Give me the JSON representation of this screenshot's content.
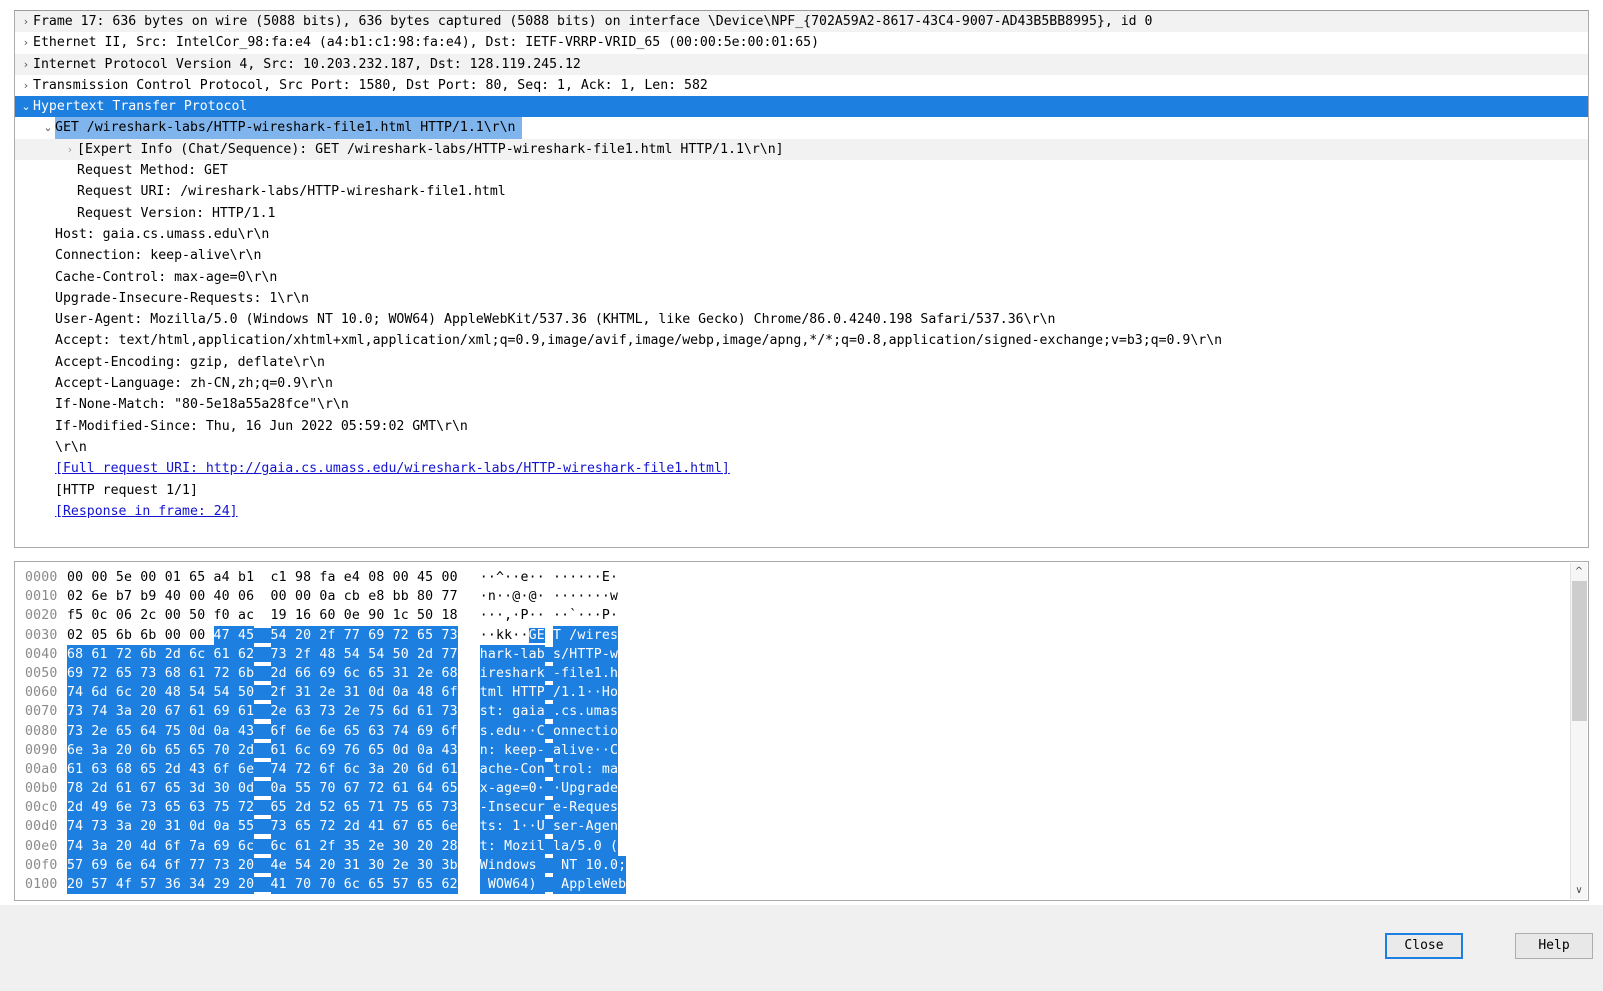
{
  "detail_tree": [
    {
      "indent": 0,
      "arrow": "collapsed",
      "state": "alt",
      "text": "Frame 17: 636 bytes on wire (5088 bits), 636 bytes captured (5088 bits) on interface \\Device\\NPF_{702A59A2-8617-43C4-9007-AD43B5BB8995}, id 0"
    },
    {
      "indent": 0,
      "arrow": "collapsed",
      "state": "plain",
      "text": "Ethernet II, Src: IntelCor_98:fa:e4 (a4:b1:c1:98:fa:e4), Dst: IETF-VRRP-VRID_65 (00:00:5e:00:01:65)"
    },
    {
      "indent": 0,
      "arrow": "collapsed",
      "state": "alt",
      "text": "Internet Protocol Version 4, Src: 10.203.232.187, Dst: 128.119.245.12"
    },
    {
      "indent": 0,
      "arrow": "collapsed",
      "state": "plain",
      "text": "Transmission Control Protocol, Src Port: 1580, Dst Port: 80, Seq: 1, Ack: 1, Len: 582"
    },
    {
      "indent": 0,
      "arrow": "expanded",
      "state": "selected",
      "text": "Hypertext Transfer Protocol"
    },
    {
      "indent": 1,
      "arrow": "expanded",
      "state": "selected-partial",
      "text": "GET /wireshark-labs/HTTP-wireshark-file1.html HTTP/1.1\\r\\n"
    },
    {
      "indent": 2,
      "arrow": "collapsed-light",
      "state": "alt",
      "text": "[Expert Info (Chat/Sequence): GET /wireshark-labs/HTTP-wireshark-file1.html HTTP/1.1\\r\\n]"
    },
    {
      "indent": 2,
      "arrow": "none",
      "state": "plain",
      "text": "Request Method: GET"
    },
    {
      "indent": 2,
      "arrow": "none",
      "state": "plain",
      "text": "Request URI: /wireshark-labs/HTTP-wireshark-file1.html"
    },
    {
      "indent": 2,
      "arrow": "none",
      "state": "plain",
      "text": "Request Version: HTTP/1.1"
    },
    {
      "indent": 1,
      "arrow": "none",
      "state": "plain",
      "text": "Host: gaia.cs.umass.edu\\r\\n"
    },
    {
      "indent": 1,
      "arrow": "none",
      "state": "plain",
      "text": "Connection: keep-alive\\r\\n"
    },
    {
      "indent": 1,
      "arrow": "none",
      "state": "plain",
      "text": "Cache-Control: max-age=0\\r\\n"
    },
    {
      "indent": 1,
      "arrow": "none",
      "state": "plain",
      "text": "Upgrade-Insecure-Requests: 1\\r\\n"
    },
    {
      "indent": 1,
      "arrow": "none",
      "state": "plain",
      "text": "User-Agent: Mozilla/5.0 (Windows NT 10.0; WOW64) AppleWebKit/537.36 (KHTML, like Gecko) Chrome/86.0.4240.198 Safari/537.36\\r\\n"
    },
    {
      "indent": 1,
      "arrow": "none",
      "state": "plain",
      "text": "Accept: text/html,application/xhtml+xml,application/xml;q=0.9,image/avif,image/webp,image/apng,*/*;q=0.8,application/signed-exchange;v=b3;q=0.9\\r\\n"
    },
    {
      "indent": 1,
      "arrow": "none",
      "state": "plain",
      "text": "Accept-Encoding: gzip, deflate\\r\\n"
    },
    {
      "indent": 1,
      "arrow": "none",
      "state": "plain",
      "text": "Accept-Language: zh-CN,zh;q=0.9\\r\\n"
    },
    {
      "indent": 1,
      "arrow": "none",
      "state": "plain",
      "text": "If-None-Match: \"80-5e18a55a28fce\"\\r\\n"
    },
    {
      "indent": 1,
      "arrow": "none",
      "state": "plain",
      "text": "If-Modified-Since: Thu, 16 Jun 2022 05:59:02 GMT\\r\\n"
    },
    {
      "indent": 1,
      "arrow": "none",
      "state": "plain",
      "text": "\\r\\n"
    },
    {
      "indent": 1,
      "arrow": "none",
      "state": "plain",
      "link": true,
      "text": "[Full request URI: http://gaia.cs.umass.edu/wireshark-labs/HTTP-wireshark-file1.html]"
    },
    {
      "indent": 1,
      "arrow": "none",
      "state": "plain",
      "text": "[HTTP request 1/1]"
    },
    {
      "indent": 1,
      "arrow": "none",
      "state": "plain",
      "link": true,
      "text": "[Response in frame: 24]"
    }
  ],
  "hex_dump": {
    "rows": [
      {
        "offset": "0000",
        "bytes": [
          "00",
          "00",
          "5e",
          "00",
          "01",
          "65",
          "a4",
          "b1",
          "c1",
          "98",
          "fa",
          "e4",
          "08",
          "00",
          "45",
          "00"
        ],
        "ascii_left": "··^··e··",
        "ascii_right": "······E·",
        "hl_start": 16
      },
      {
        "offset": "0010",
        "bytes": [
          "02",
          "6e",
          "b7",
          "b9",
          "40",
          "00",
          "40",
          "06",
          "00",
          "00",
          "0a",
          "cb",
          "e8",
          "bb",
          "80",
          "77"
        ],
        "ascii_left": "·n··@·@·",
        "ascii_right": "·······w",
        "hl_start": 16
      },
      {
        "offset": "0020",
        "bytes": [
          "f5",
          "0c",
          "06",
          "2c",
          "00",
          "50",
          "f0",
          "ac",
          "19",
          "16",
          "60",
          "0e",
          "90",
          "1c",
          "50",
          "18"
        ],
        "ascii_left": "···,·P··",
        "ascii_right": "··`···P·",
        "hl_start": 16
      },
      {
        "offset": "0030",
        "bytes": [
          "02",
          "05",
          "6b",
          "6b",
          "00",
          "00",
          "47",
          "45",
          "54",
          "20",
          "2f",
          "77",
          "69",
          "72",
          "65",
          "73"
        ],
        "ascii_left": "··kk··GE",
        "ascii_right": "T /wires",
        "hl_start": 6
      },
      {
        "offset": "0040",
        "bytes": [
          "68",
          "61",
          "72",
          "6b",
          "2d",
          "6c",
          "61",
          "62",
          "73",
          "2f",
          "48",
          "54",
          "54",
          "50",
          "2d",
          "77"
        ],
        "ascii_left": "hark-lab",
        "ascii_right": "s/HTTP-w",
        "hl_start": 0
      },
      {
        "offset": "0050",
        "bytes": [
          "69",
          "72",
          "65",
          "73",
          "68",
          "61",
          "72",
          "6b",
          "2d",
          "66",
          "69",
          "6c",
          "65",
          "31",
          "2e",
          "68"
        ],
        "ascii_left": "ireshark",
        "ascii_right": "-file1.h",
        "hl_start": 0
      },
      {
        "offset": "0060",
        "bytes": [
          "74",
          "6d",
          "6c",
          "20",
          "48",
          "54",
          "54",
          "50",
          "2f",
          "31",
          "2e",
          "31",
          "0d",
          "0a",
          "48",
          "6f"
        ],
        "ascii_left": "tml HTTP",
        "ascii_right": "/1.1··Ho",
        "hl_start": 0
      },
      {
        "offset": "0070",
        "bytes": [
          "73",
          "74",
          "3a",
          "20",
          "67",
          "61",
          "69",
          "61",
          "2e",
          "63",
          "73",
          "2e",
          "75",
          "6d",
          "61",
          "73"
        ],
        "ascii_left": "st: gaia",
        "ascii_right": ".cs.umas",
        "hl_start": 0
      },
      {
        "offset": "0080",
        "bytes": [
          "73",
          "2e",
          "65",
          "64",
          "75",
          "0d",
          "0a",
          "43",
          "6f",
          "6e",
          "6e",
          "65",
          "63",
          "74",
          "69",
          "6f"
        ],
        "ascii_left": "s.edu··C",
        "ascii_right": "onnectio",
        "hl_start": 0
      },
      {
        "offset": "0090",
        "bytes": [
          "6e",
          "3a",
          "20",
          "6b",
          "65",
          "65",
          "70",
          "2d",
          "61",
          "6c",
          "69",
          "76",
          "65",
          "0d",
          "0a",
          "43"
        ],
        "ascii_left": "n: keep-",
        "ascii_right": "alive··C",
        "hl_start": 0
      },
      {
        "offset": "00a0",
        "bytes": [
          "61",
          "63",
          "68",
          "65",
          "2d",
          "43",
          "6f",
          "6e",
          "74",
          "72",
          "6f",
          "6c",
          "3a",
          "20",
          "6d",
          "61"
        ],
        "ascii_left": "ache-Con",
        "ascii_right": "trol: ma",
        "hl_start": 0
      },
      {
        "offset": "00b0",
        "bytes": [
          "78",
          "2d",
          "61",
          "67",
          "65",
          "3d",
          "30",
          "0d",
          "0a",
          "55",
          "70",
          "67",
          "72",
          "61",
          "64",
          "65"
        ],
        "ascii_left": "x-age=0·",
        "ascii_right": "·Upgrade",
        "hl_start": 0
      },
      {
        "offset": "00c0",
        "bytes": [
          "2d",
          "49",
          "6e",
          "73",
          "65",
          "63",
          "75",
          "72",
          "65",
          "2d",
          "52",
          "65",
          "71",
          "75",
          "65",
          "73"
        ],
        "ascii_left": "-Insecur",
        "ascii_right": "e-Reques",
        "hl_start": 0
      },
      {
        "offset": "00d0",
        "bytes": [
          "74",
          "73",
          "3a",
          "20",
          "31",
          "0d",
          "0a",
          "55",
          "73",
          "65",
          "72",
          "2d",
          "41",
          "67",
          "65",
          "6e"
        ],
        "ascii_left": "ts: 1··U",
        "ascii_right": "ser-Agen",
        "hl_start": 0
      },
      {
        "offset": "00e0",
        "bytes": [
          "74",
          "3a",
          "20",
          "4d",
          "6f",
          "7a",
          "69",
          "6c",
          "6c",
          "61",
          "2f",
          "35",
          "2e",
          "30",
          "20",
          "28"
        ],
        "ascii_left": "t: Mozil",
        "ascii_right": "la/5.0 (",
        "hl_start": 0
      },
      {
        "offset": "00f0",
        "bytes": [
          "57",
          "69",
          "6e",
          "64",
          "6f",
          "77",
          "73",
          "20",
          "4e",
          "54",
          "20",
          "31",
          "30",
          "2e",
          "30",
          "3b"
        ],
        "ascii_left": "Windows ",
        "ascii_right": " NT 10.0;",
        "hl_start": 0
      },
      {
        "offset": "0100",
        "bytes": [
          "20",
          "57",
          "4f",
          "57",
          "36",
          "34",
          "29",
          "20",
          "41",
          "70",
          "70",
          "6c",
          "65",
          "57",
          "65",
          "62"
        ],
        "ascii_left": " WOW64) ",
        "ascii_right": " AppleWeb",
        "hl_start": 0
      }
    ]
  },
  "scrollbar": {
    "up_arrow": "chevron-up-icon",
    "down_arrow": "chevron-down-icon"
  },
  "footer": {
    "close_label": "Close",
    "help_label": "Help"
  },
  "colors": {
    "selection_blue": "#1d7fe0",
    "selection_light": "#7fb5ec",
    "link": "#1414cf",
    "alt_row": "#f2f2f2"
  }
}
